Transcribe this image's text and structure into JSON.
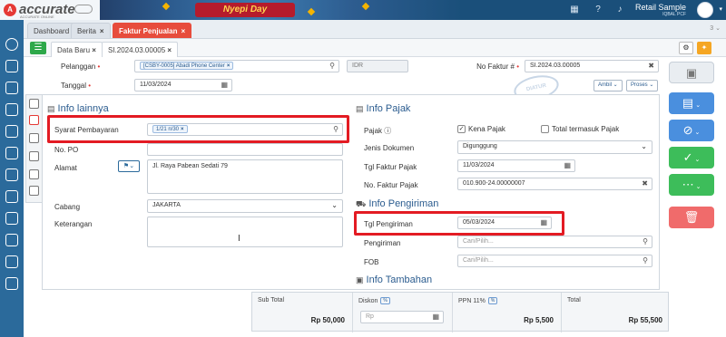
{
  "app": {
    "logo_text": "accurate",
    "logo_sub": "ACCURATE ONLINE",
    "promo": "Nyepi Day",
    "user_name": "Retail Sample",
    "user_sub": "IQBAL PCF",
    "colors": {
      "topbar": "#1a4f7a",
      "sidebar": "#2b6a9b",
      "active_tab": "#e74c3c",
      "highlight": "#e31b23",
      "accent": "#2b5c8f"
    }
  },
  "tabs": [
    {
      "label": "Dashboard",
      "closable": false
    },
    {
      "label": "Berita",
      "closable": true
    },
    {
      "label": "Faktur Penjualan",
      "closable": true
    }
  ],
  "tab_count": "3",
  "subtabs": [
    {
      "label": "Data Baru",
      "closable": true
    },
    {
      "label": "SI.2024.03.00005",
      "closable": true
    }
  ],
  "header": {
    "pelanggan_label": "Pelanggan",
    "pelanggan_value": "[CSBY-0005] Abadi Phone Center",
    "currency": "IDR",
    "tanggal_label": "Tanggal",
    "tanggal_value": "11/03/2024",
    "no_faktur_label": "No Faktur #",
    "no_faktur_value": "SI.2024.03.00005",
    "ambil_label": "Ambil",
    "proses_label": "Proses",
    "stamp": "DIATUR OTOMATIS"
  },
  "info_lainnya": {
    "title": "Info lainnya",
    "syarat_label": "Syarat Pembayaran",
    "syarat_value": "1/21 n/30",
    "no_po_label": "No. PO",
    "no_po_value": "",
    "alamat_label": "Alamat",
    "alamat_value": "Jl. Raya Pabean Sedati 79",
    "cabang_label": "Cabang",
    "cabang_value": "JAKARTA",
    "keterangan_label": "Keterangan",
    "keterangan_value": ""
  },
  "info_pajak": {
    "title": "Info Pajak",
    "pajak_label": "Pajak",
    "kena_pajak_label": "Kena Pajak",
    "kena_pajak_checked": true,
    "total_termasuk_label": "Total termasuk Pajak",
    "total_termasuk_checked": false,
    "jenis_dokumen_label": "Jenis Dokumen",
    "jenis_dokumen_value": "Digunggung",
    "tgl_faktur_label": "Tgl Faktur Pajak",
    "tgl_faktur_value": "11/03/2024",
    "no_faktur_pajak_label": "No. Faktur Pajak",
    "no_faktur_pajak_value": "010.900-24.00000007"
  },
  "info_pengiriman": {
    "title": "Info Pengiriman",
    "tgl_pengiriman_label": "Tgl Pengiriman",
    "tgl_pengiriman_value": "05/03/2024",
    "pengiriman_label": "Pengiriman",
    "pengiriman_placeholder": "Cari/Pilih...",
    "fob_label": "FOB",
    "fob_placeholder": "Cari/Pilih..."
  },
  "info_tambahan": {
    "title": "Info Tambahan"
  },
  "totals": {
    "sub_total_label": "Sub Total",
    "sub_total_value": "Rp 50,000",
    "diskon_label": "Diskon",
    "diskon_placeholder": "Rp",
    "ppn_label": "PPN 11%",
    "ppn_value": "Rp 5,500",
    "total_label": "Total",
    "total_value": "Rp 55,500"
  }
}
